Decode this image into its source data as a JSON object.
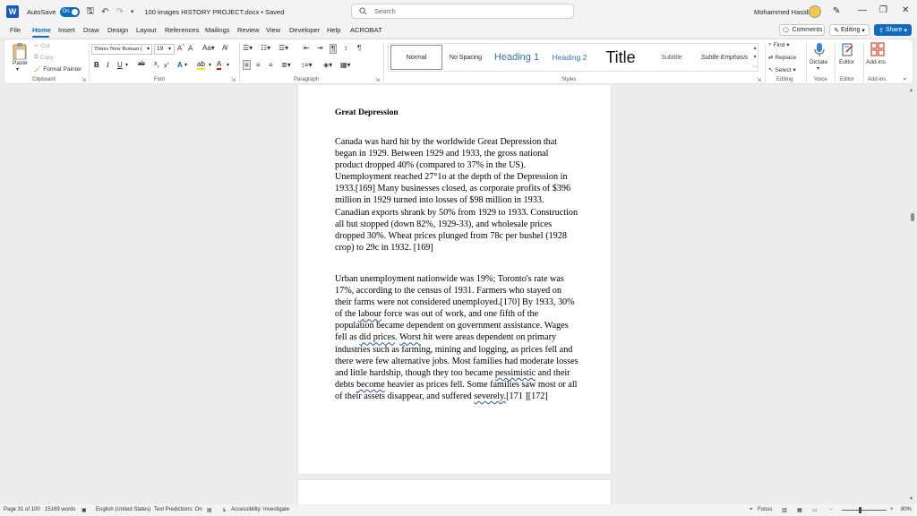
{
  "titlebar": {
    "autosave_label": "AutoSave",
    "autosave_state": "On",
    "document_title": "100 images HISTORY PROJECT.docx • Saved",
    "search_placeholder": "Search",
    "user_name": "Mohammed Hassbo"
  },
  "menu": {
    "items": [
      "File",
      "Home",
      "Insert",
      "Draw",
      "Design",
      "Layout",
      "References",
      "Mailings",
      "Review",
      "View",
      "Developer",
      "Help",
      "ACROBAT"
    ],
    "active": "Home",
    "comments_label": "Comments",
    "editing_label": "Editing",
    "share_label": "Share"
  },
  "ribbon": {
    "clipboard": {
      "paste": "Paste",
      "cut": "Cut",
      "copy": "Copy",
      "format_painter": "Format Painter",
      "label": "Clipboard"
    },
    "font": {
      "name": "Times New Roman (",
      "size": "19",
      "label": "Font"
    },
    "paragraph": {
      "label": "Paragraph"
    },
    "styles": {
      "items": [
        "Normal",
        "No Spacing",
        "Heading 1",
        "Heading 2",
        "Title",
        "Subtitle",
        "Subtle Emphasis"
      ],
      "label": "Styles"
    },
    "editing": {
      "find": "Find",
      "replace": "Replace",
      "select": "Select",
      "label": "Editing"
    },
    "voice": {
      "dictate": "Dictate",
      "label": "Voice"
    },
    "editor": {
      "editor": "Editor",
      "label": "Editor"
    },
    "addins": {
      "addins": "Add-ins"
    }
  },
  "document": {
    "heading": "Great Depression",
    "para1": "Canada was hard hit by the worldwide Great Depression that began in 1929. Between 1929 and 1933, the gross national product dropped 40% (compared to 37% in the US). Unemployment reached 27°1o at the depth of the Depression in 1933.[169] Many businesses closed, as corporate profits of $396 million in 1929 turned into losses of $98 million in 1933. Canadian exports shrank by 50% from 1929 to 1933. Construction all but stopped (down 82%, 1929-33), and wholesale prices dropped 30%. Wheat prices plunged from 78c per bushel (1928 crop) to 29c in 1932. [169]",
    "para2": {
      "p1": "Urban unemployment nationwide was 19%; Toronto's rate was 17%, according to the census of 1931. Farmers who stayed on their farms were not considered unemployed.[170] By 1933, 30% of the ",
      "w1": "labour",
      "p2": " force was out of work, and one fifth of the population became dependent on government assistance. Wages fell as ",
      "w2": "did prices",
      "p3": ". ",
      "w3": "Worst",
      "p4": " hit were areas dependent on primary industries such as farming, mining and logging, as prices fell and there were few alternative jobs. Most families had moderate losses and little hardship, though they too became ",
      "w4": "pessimistic",
      "p5": " and their debts ",
      "w5": "become",
      "p6": " heavier as prices fell. Some families saw most or all of their assets disappear, and suffered ",
      "w6": "severely.",
      "p7": "[171 ][172]"
    }
  },
  "status": {
    "page": "Page 31 of 100",
    "words": "15169 words",
    "language": "English (United States)",
    "predictions": "Text Predictions: On",
    "accessibility": "Accessibility: Investigate",
    "focus": "Focus",
    "zoom": "80%"
  }
}
